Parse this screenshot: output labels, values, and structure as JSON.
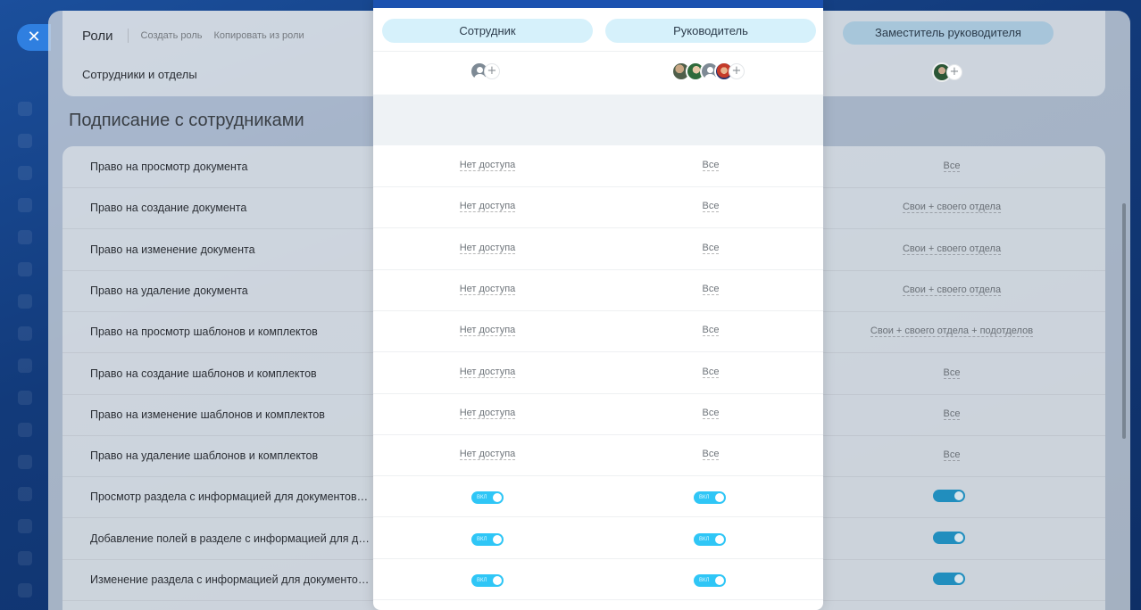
{
  "window": {
    "close_icon": "✕"
  },
  "header": {
    "roles_title": "Роли",
    "create_role": "Создать роль",
    "copy_role": "Копировать из роли",
    "employees_and_departments": "Сотрудники и отделы"
  },
  "columns": [
    {
      "name": "Сотрудник"
    },
    {
      "name": "Руководитель"
    },
    {
      "name": "Заместитель руководителя"
    }
  ],
  "add_symbol": "+",
  "section": {
    "title": "Подписание с сотрудниками"
  },
  "toggle_label": "ВКЛ",
  "rights": [
    {
      "label": "Право на просмотр документа",
      "values": [
        "Нет доступа",
        "Все",
        "Все"
      ]
    },
    {
      "label": "Право на создание документа",
      "values": [
        "Нет доступа",
        "Все",
        "Свои + своего отдела"
      ]
    },
    {
      "label": "Право на изменение документа",
      "values": [
        "Нет доступа",
        "Все",
        "Свои + своего отдела"
      ]
    },
    {
      "label": "Право на удаление документа",
      "values": [
        "Нет доступа",
        "Все",
        "Свои + своего отдела"
      ]
    },
    {
      "label": "Право на просмотр шаблонов и комплектов",
      "values": [
        "Нет доступа",
        "Все",
        "Свои + своего отдела + подотделов"
      ]
    },
    {
      "label": "Право на создание шаблонов и комплектов",
      "values": [
        "Нет доступа",
        "Все",
        "Все"
      ]
    },
    {
      "label": "Право на изменение шаблонов и комплектов",
      "values": [
        "Нет доступа",
        "Все",
        "Все"
      ]
    },
    {
      "label": "Право на удаление шаблонов и комплектов",
      "values": [
        "Нет доступа",
        "Все",
        "Все"
      ]
    },
    {
      "label": "Просмотр раздела с информацией для документов в пр...",
      "values": [],
      "toggle": true
    },
    {
      "label": "Добавление полей в разделе с информацией для докум...",
      "values": [],
      "toggle": true
    },
    {
      "label": "Изменение раздела с информацией для документов в п...",
      "values": [],
      "toggle": true
    }
  ],
  "colors": {
    "accent": "#2fc6f6",
    "pill": "#d6f1fb",
    "topbar": "#1c52b0"
  }
}
